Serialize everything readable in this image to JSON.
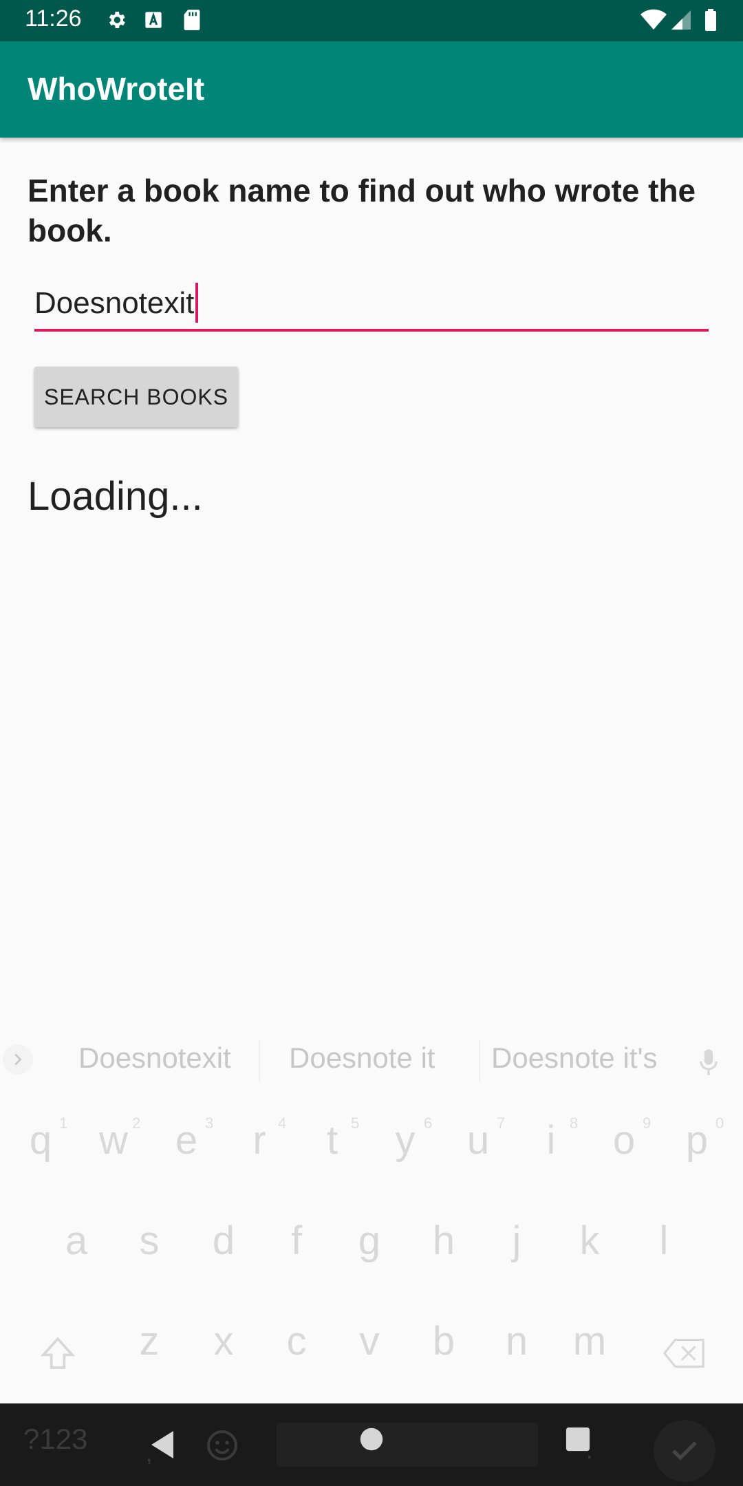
{
  "status_bar": {
    "time": "11:26",
    "icons": [
      "gear-icon",
      "a-badge-icon",
      "sd-card-icon",
      "wifi-icon",
      "signal-icon",
      "battery-icon"
    ]
  },
  "app_bar": {
    "title": "WhoWroteIt"
  },
  "main": {
    "instructions": "Enter a book name to find out who wrote the book.",
    "book_input": {
      "value": "Doesnotexit"
    },
    "search_button": {
      "label": "SEARCH BOOKS"
    },
    "status_text": "Loading..."
  },
  "keyboard": {
    "suggestions": [
      "Doesnotexit",
      "Doesnote it",
      "Doesnote it's"
    ],
    "row1": [
      "q",
      "w",
      "e",
      "r",
      "t",
      "y",
      "u",
      "i",
      "o",
      "p"
    ],
    "row1_numbers": [
      "1",
      "2",
      "3",
      "4",
      "5",
      "6",
      "7",
      "8",
      "9",
      "0"
    ],
    "row2": [
      "a",
      "s",
      "d",
      "f",
      "g",
      "h",
      "j",
      "k",
      "l"
    ],
    "row3": [
      "z",
      "x",
      "c",
      "v",
      "b",
      "n",
      "m"
    ],
    "symbols_key": "?123",
    "comma_key": ",",
    "period_key": "."
  },
  "colors": {
    "status_bar": "#00574b",
    "app_bar": "#008577",
    "accent": "#d81b60",
    "button": "#d6d6d6"
  }
}
